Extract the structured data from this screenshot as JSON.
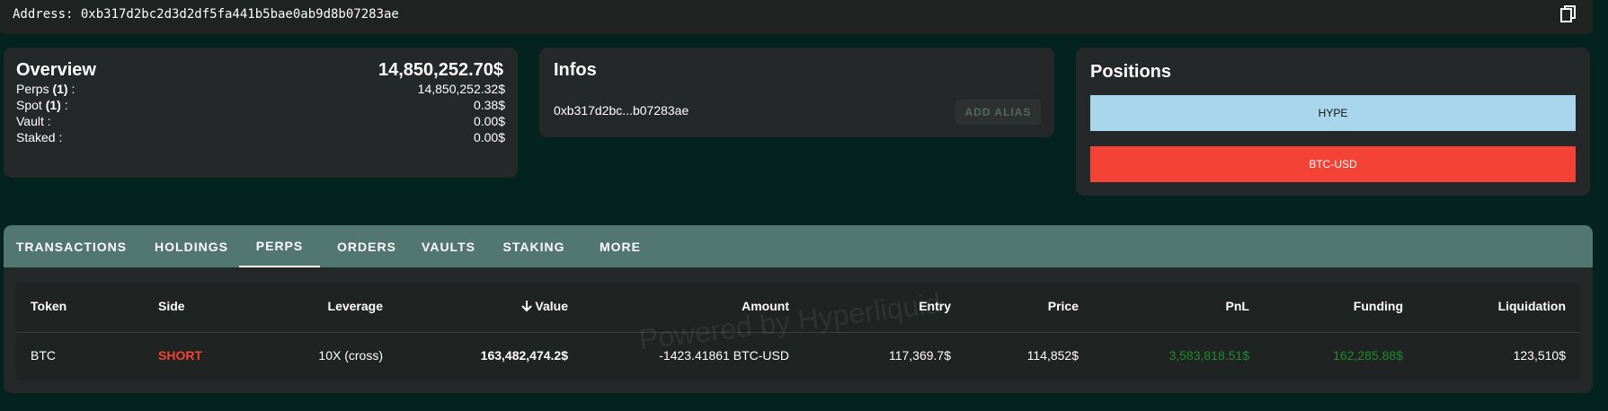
{
  "address_bar": {
    "text": "Address: 0xb317d2bc2d3d2df5fa441b5bae0ab9d8b07283ae",
    "copy_icon": "copy-icon"
  },
  "overview": {
    "title": "Overview",
    "total": "14,850,252.70$",
    "rows": [
      {
        "label": "Perps",
        "count": "(1)",
        "suffix": " :",
        "value": "14,850,252.32$"
      },
      {
        "label": "Spot",
        "count": "(1)",
        "suffix": " :",
        "value": "0.38$"
      },
      {
        "label": "Vault :",
        "count": "",
        "suffix": "",
        "value": "0.00$"
      },
      {
        "label": "Staked :",
        "count": "",
        "suffix": "",
        "value": "0.00$"
      }
    ]
  },
  "infos": {
    "title": "Infos",
    "short_address": "0xb317d2bc...b07283ae",
    "add_alias_label": "ADD ALIAS"
  },
  "positions": {
    "title": "Positions",
    "items": [
      "HYPE",
      "BTC-USD"
    ],
    "colors": {
      "HYPE": "#a9d6ec",
      "BTC-USD": "#f44336"
    }
  },
  "tabs": [
    "TRANSACTIONS",
    "HOLDINGS",
    "PERPS",
    "ORDERS",
    "VAULTS",
    "STAKING",
    "MORE"
  ],
  "active_tab": "PERPS",
  "table": {
    "columns": [
      "Token",
      "Side",
      "Leverage",
      "Value",
      "Amount",
      "Entry",
      "Price",
      "PnL",
      "Funding",
      "Liquidation"
    ],
    "sort_icon": "arrow-down-icon",
    "rows": [
      {
        "token": "BTC",
        "side": "SHORT",
        "leverage": "10X (cross)",
        "value": "163,482,474.2$",
        "amount": "-1423.41861 BTC-USD",
        "entry": "117,369.7$",
        "price": "114,852$",
        "pnl": "3,583,818.51$",
        "funding": "162,285.88$",
        "liquidation": "123,510$"
      }
    ]
  },
  "watermark": "Powered by Hyperliquid",
  "colors": {
    "accent_tab": "#527670",
    "short": "#f44336",
    "positive": "#1f8a2e"
  }
}
